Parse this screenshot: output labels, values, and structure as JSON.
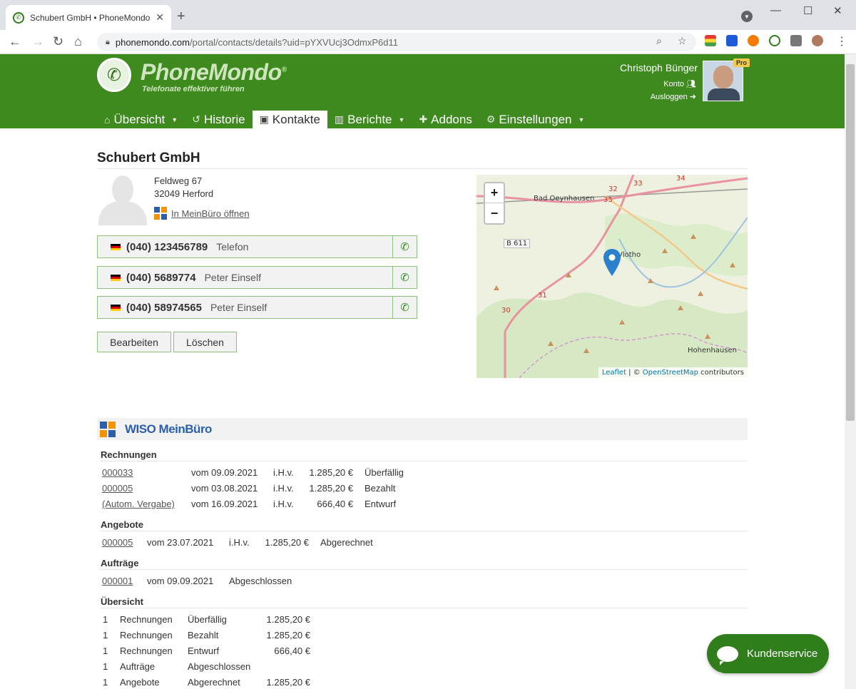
{
  "browser": {
    "tab_title": "Schubert GmbH • PhoneMondo",
    "url_host": "phonemondo.com",
    "url_path": "/portal/contacts/details?uid=pYXVUcj3OdmxP6d11"
  },
  "header": {
    "logo_text": "PhoneMondo",
    "logo_mark": "®",
    "tagline": "Telefonate effektiver führen",
    "user_name": "Christoph Bünger",
    "konto_label": "Konto",
    "logout_label": "Ausloggen",
    "pro_badge": "Pro"
  },
  "nav": {
    "items": [
      {
        "label": "Übersicht",
        "icon": "home-icon"
      },
      {
        "label": "Historie",
        "icon": "history-icon"
      },
      {
        "label": "Kontakte",
        "icon": "contacts-icon"
      },
      {
        "label": "Berichte",
        "icon": "bar-chart-icon"
      },
      {
        "label": "Addons",
        "icon": "puzzle-icon"
      },
      {
        "label": "Einstellungen",
        "icon": "gear-icon"
      }
    ]
  },
  "contact": {
    "name": "Schubert GmbH",
    "street": "Feldweg 67",
    "city": "32049 Herford",
    "meinbuero_link": "In MeinBüro öffnen",
    "phones": [
      {
        "number": "(040) 123456789",
        "label": "Telefon"
      },
      {
        "number": "(040) 5689774",
        "label": "Peter Einself"
      },
      {
        "number": "(040) 58974565",
        "label": "Peter Einself"
      }
    ],
    "edit_label": "Bearbeiten",
    "delete_label": "Löschen"
  },
  "map": {
    "zoom_in": "+",
    "zoom_out": "−",
    "attribution_leaflet": "Leaflet",
    "attribution_sep": " | © ",
    "attribution_osm": "OpenStreetMap",
    "attribution_tail": " contributors",
    "labels": {
      "bad_oeynhausen": "Bad Oeynhausen",
      "vlotho": "Vlotho",
      "hohenhausen": "Hohenhausen",
      "b611": "B 611",
      "road_31": "31",
      "road_30": "30",
      "road_32": "32",
      "road_33": "33",
      "road_34": "34",
      "road_35": "35"
    }
  },
  "meinbuero": {
    "brand": "WISO MeinBüro",
    "rechnungen_title": "Rechnungen",
    "rechnungen": [
      {
        "id": "000033",
        "date": "vom 09.09.2021",
        "ihv": "i.H.v.",
        "amount": "1.285,20 €",
        "status": "Überfällig"
      },
      {
        "id": "000005",
        "date": "vom 03.08.2021",
        "ihv": "i.H.v.",
        "amount": "1.285,20 €",
        "status": "Bezahlt"
      },
      {
        "id": "(Autom. Vergabe)",
        "date": "vom 16.09.2021",
        "ihv": "i.H.v.",
        "amount": "666,40 €",
        "status": "Entwurf"
      }
    ],
    "angebote_title": "Angebote",
    "angebote": [
      {
        "id": "000005",
        "date": "vom 23.07.2021",
        "ihv": "i.H.v.",
        "amount": "1.285,20 €",
        "status": "Abgerechnet"
      }
    ],
    "auftraege_title": "Aufträge",
    "auftraege": [
      {
        "id": "000001",
        "date": "vom 09.09.2021",
        "status": "Abgeschlossen"
      }
    ],
    "uebersicht_title": "Übersicht",
    "uebersicht": [
      {
        "count": "1",
        "type": "Rechnungen",
        "status": "Überfällig",
        "amount": "1.285,20 €"
      },
      {
        "count": "1",
        "type": "Rechnungen",
        "status": "Bezahlt",
        "amount": "1.285,20 €"
      },
      {
        "count": "1",
        "type": "Rechnungen",
        "status": "Entwurf",
        "amount": "666,40 €"
      },
      {
        "count": "1",
        "type": "Aufträge",
        "status": "Abgeschlossen",
        "amount": ""
      },
      {
        "count": "1",
        "type": "Angebote",
        "status": "Abgerechnet",
        "amount": "1.285,20 €"
      }
    ]
  },
  "support": {
    "label": "Kundenservice"
  },
  "colors": {
    "brand_green": "#3e8a1f",
    "accent_green": "#2f7d1b",
    "link_blue": "#0078a8"
  }
}
